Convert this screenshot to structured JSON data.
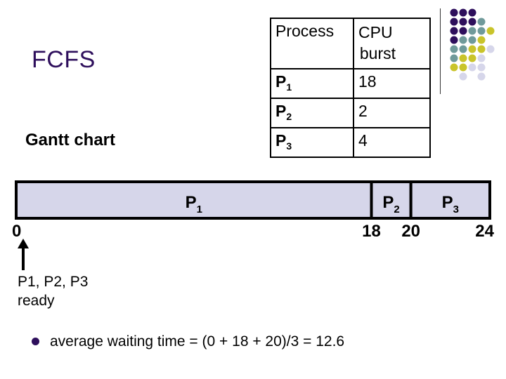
{
  "slide": {
    "title": "FCFS",
    "subtitle": "Gantt chart",
    "colors": {
      "title": "#2e0f5c",
      "gantt_fill": "#d6d6ea",
      "dot_purple": "#2e0f5c",
      "dot_teal": "#6f9a9a",
      "dot_yellow": "#c9c42a",
      "dot_lavender": "#d6d6ea"
    }
  },
  "table": {
    "headers": [
      "Process",
      "CPU",
      "burst"
    ],
    "rows": [
      {
        "name": "P",
        "sub": "1",
        "burst": "18"
      },
      {
        "name": "P",
        "sub": "2",
        "burst": "2"
      },
      {
        "name": "P",
        "sub": "3",
        "burst": "4"
      }
    ]
  },
  "chart_data": {
    "type": "gantt",
    "title": "Gantt chart",
    "segments": [
      {
        "name": "P",
        "sub": "1",
        "start": 0,
        "end": 18
      },
      {
        "name": "P",
        "sub": "2",
        "start": 18,
        "end": 20
      },
      {
        "name": "P",
        "sub": "3",
        "start": 20,
        "end": 24
      }
    ],
    "ticks": [
      0,
      18,
      20,
      24
    ],
    "xlim": [
      0,
      24
    ]
  },
  "annotation": {
    "ready_lines": [
      "P1, P2, P3",
      "ready"
    ]
  },
  "bullet": {
    "text": "average waiting time = (0 + 18 + 20)/3 = 12.6"
  },
  "decoration": {
    "dot_grid": [
      "PPP..",
      "PPPT.",
      "PPTTY",
      "PTTY.",
      "TTYYL",
      "TYYL.",
      "YYLL.",
      ".L.L."
    ]
  }
}
